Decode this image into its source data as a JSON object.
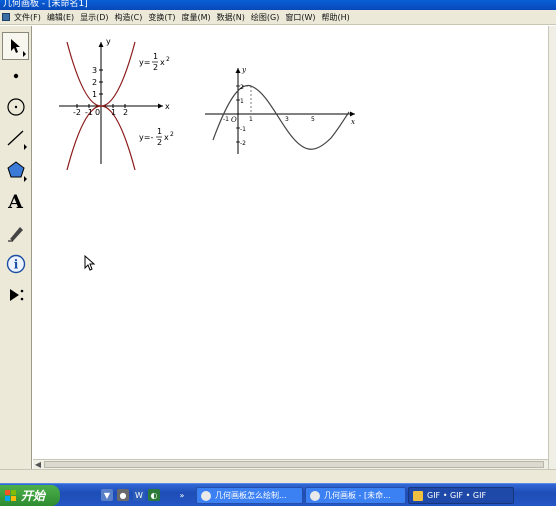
{
  "window": {
    "title": "几何画板 - [未命名1]"
  },
  "menu": [
    "文件(F)",
    "编辑(E)",
    "显示(D)",
    "构造(C)",
    "变换(T)",
    "度量(M)",
    "数据(N)",
    "绘图(G)",
    "窗口(W)",
    "帮助(H)"
  ],
  "toolbox": [
    {
      "name": "arrow-select-tool",
      "selected": true
    },
    {
      "name": "point-tool"
    },
    {
      "name": "compass-tool"
    },
    {
      "name": "straightedge-tool"
    },
    {
      "name": "polygon-tool"
    },
    {
      "name": "text-tool",
      "glyph": "A"
    },
    {
      "name": "marker-tool"
    },
    {
      "name": "information-tool"
    },
    {
      "name": "custom-tool"
    }
  ],
  "graph1": {
    "y_axis": "y",
    "x_axis": "x",
    "y_ticks": [
      "3",
      "2",
      "1"
    ],
    "x_ticks": [
      "-2",
      "-1",
      "0",
      "1",
      "2"
    ],
    "upper_label": {
      "prefix": "y=",
      "num": "1",
      "den": "2",
      "var": "x",
      "exp": "2"
    },
    "lower_label": {
      "prefix": "y=-",
      "num": "1",
      "den": "2",
      "var": "x",
      "exp": "2"
    }
  },
  "graph2": {
    "y_axis": "y",
    "x_axis": "x",
    "origin": "O",
    "y_ticks": [
      "2",
      "1",
      "-1",
      "-2"
    ],
    "x_ticks": [
      "-1",
      "1",
      "3",
      "5"
    ]
  },
  "taskbar": {
    "start_label": "开始",
    "tasks": [
      {
        "label": "几何画板怎么绘制..."
      },
      {
        "label": "几何画板 - [未命..."
      },
      {
        "label": "GIF • GIF • GIF",
        "active": true
      }
    ]
  }
}
